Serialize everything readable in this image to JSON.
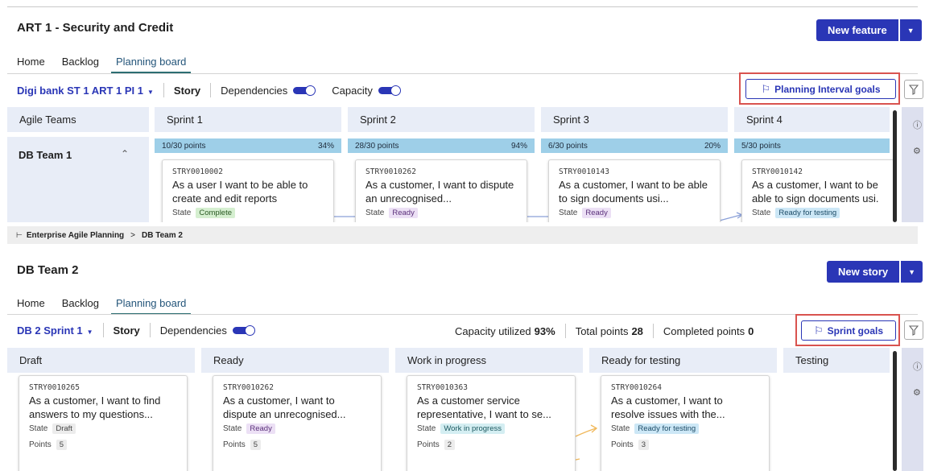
{
  "colors": {
    "accent": "#2a36b6",
    "highlight_outline": "#d9534f",
    "column_header_bg": "#e8edf7",
    "capacity_bar": "#9ecfe8"
  },
  "art": {
    "title": "ART 1 - Security and Credit",
    "primary_button": "New feature",
    "tabs": [
      "Home",
      "Backlog",
      "Planning board"
    ],
    "active_tab": "Planning board",
    "toolbar": {
      "pi_select": "Digi bank ST 1 ART 1 PI 1",
      "story_label": "Story",
      "dependencies_label": "Dependencies",
      "capacity_label": "Capacity",
      "goals_button": "Planning Interval goals"
    },
    "teams_header": "Agile Teams",
    "team_name": "DB Team 1",
    "sprints": [
      {
        "name": "Sprint 1",
        "points": "10/30 points",
        "pct": "34%",
        "fill": 1.0,
        "card": {
          "number": "STRY0010002",
          "text": "As a user I want to be able to create and edit reports",
          "state_label": "State",
          "state": "Complete",
          "state_kind": "complete"
        }
      },
      {
        "name": "Sprint 2",
        "points": "28/30 points",
        "pct": "94%",
        "fill": 1.0,
        "card": {
          "number": "STRY0010262",
          "text": "As a customer, I want to dispute an unrecognised...",
          "state_label": "State",
          "state": "Ready",
          "state_kind": "ready"
        }
      },
      {
        "name": "Sprint 3",
        "points": "6/30 points",
        "pct": "20%",
        "fill": 1.0,
        "card": {
          "number": "STRY0010143",
          "text": "As a customer, I want to be able to sign documents usi...",
          "state_label": "State",
          "state": "Ready",
          "state_kind": "ready"
        }
      },
      {
        "name": "Sprint 4",
        "points": "5/30 points",
        "pct": "",
        "fill": 1.0,
        "card": {
          "number": "STRY0010142",
          "text": "As a customer, I want to be able to sign documents usi.",
          "state_label": "State",
          "state": "Ready for testing",
          "state_kind": "testing"
        }
      }
    ]
  },
  "breadcrumb": {
    "root": "Enterprise Agile Planning",
    "separator": ">",
    "current": "DB Team 2"
  },
  "team2": {
    "title": "DB Team 2",
    "primary_button": "New story",
    "tabs": [
      "Home",
      "Backlog",
      "Planning board"
    ],
    "active_tab": "Planning board",
    "toolbar": {
      "sprint_select": "DB 2 Sprint 1",
      "story_label": "Story",
      "dependencies_label": "Dependencies",
      "capacity_utilized_label": "Capacity utilized",
      "capacity_utilized_value": "93%",
      "total_points_label": "Total points",
      "total_points_value": "28",
      "completed_points_label": "Completed points",
      "completed_points_value": "0",
      "goals_button": "Sprint goals"
    },
    "columns": [
      {
        "name": "Draft",
        "card": {
          "number": "STRY0010265",
          "text": "As a customer, I want to find answers to my questions...",
          "state_label": "State",
          "state": "Draft",
          "state_kind": "draft",
          "points_label": "Points",
          "points": "5"
        }
      },
      {
        "name": "Ready",
        "card": {
          "number": "STRY0010262",
          "text": "As a customer, I want to dispute an unrecognised...",
          "state_label": "State",
          "state": "Ready",
          "state_kind": "ready",
          "points_label": "Points",
          "points": "5"
        }
      },
      {
        "name": "Work in progress",
        "card": {
          "number": "STRY0010363",
          "text": "As a customer service representative, I want to se...",
          "state_label": "State",
          "state": "Work in progress",
          "state_kind": "wip",
          "points_label": "Points",
          "points": "2"
        }
      },
      {
        "name": "Ready for testing",
        "card": {
          "number": "STRY0010264",
          "text": "As a customer, I want to resolve issues with the...",
          "state_label": "State",
          "state": "Ready for testing",
          "state_kind": "testing",
          "points_label": "Points",
          "points": "3"
        }
      },
      {
        "name": "Testing",
        "card": null
      }
    ]
  },
  "icons": {
    "info": "info-icon",
    "settings": "gear-icon",
    "filter": "filter-icon",
    "flag": "flag-icon",
    "collapse": "chevron-up-icon",
    "tree": "hierarchy-icon"
  }
}
